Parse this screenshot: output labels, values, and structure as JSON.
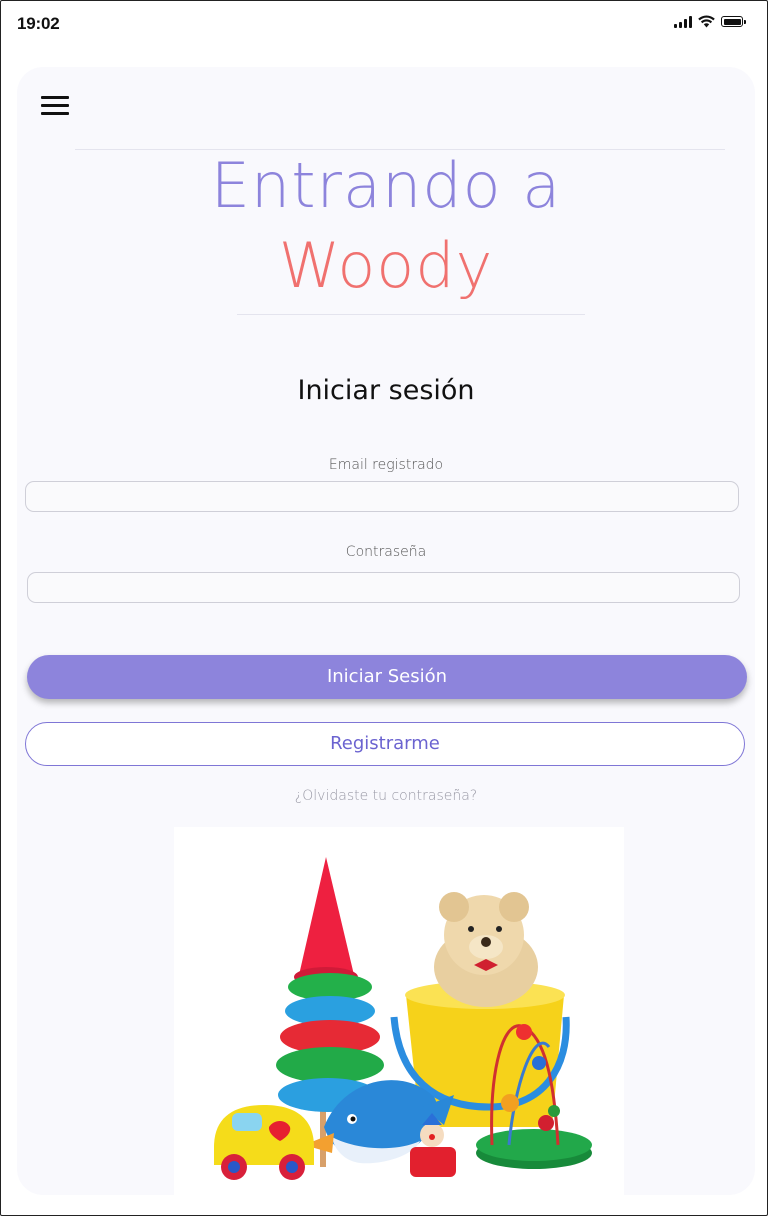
{
  "status_bar": {
    "time": "19:02",
    "icons": [
      "cellular-signal-icon",
      "wifi-icon",
      "battery-icon"
    ]
  },
  "header": {
    "menu_icon": "hamburger-menu-icon"
  },
  "hero": {
    "line1": "Entrando a",
    "line2": "Woody",
    "line1_color": "#8d84dc",
    "line2_color": "#f0716f"
  },
  "login": {
    "heading": "Iniciar sesión",
    "email_label": "Email registrado",
    "email_value": "",
    "password_label": "Contraseña",
    "password_value": "",
    "submit_label": "Iniciar Sesión",
    "register_label": "Registrarme",
    "forgot_label": "¿Olvidaste tu contraseña?"
  },
  "image": {
    "subject": "toys-illustration"
  },
  "colors": {
    "accent": "#8d84dc",
    "brand_red": "#f0716f",
    "card_bg": "#f9f9fd"
  }
}
